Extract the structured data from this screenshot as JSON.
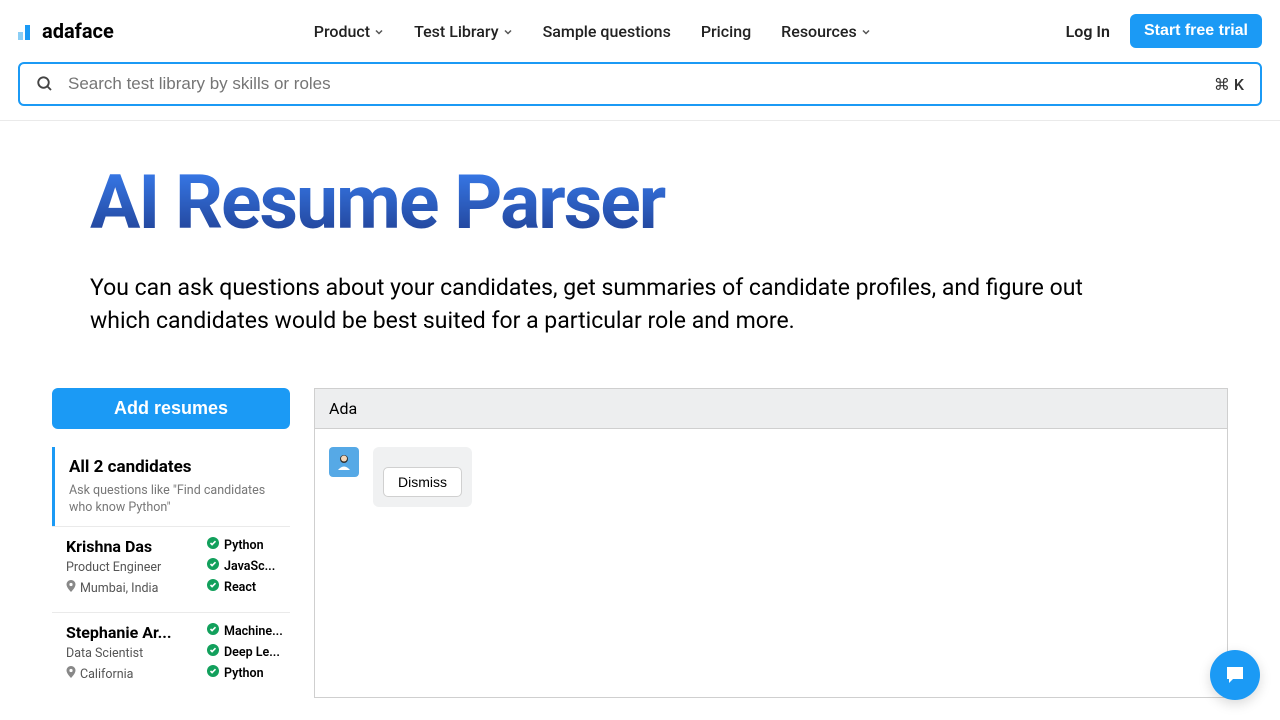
{
  "brand": "adaface",
  "nav": {
    "items": [
      {
        "label": "Product",
        "hasChevron": true
      },
      {
        "label": "Test Library",
        "hasChevron": true
      },
      {
        "label": "Sample questions",
        "hasChevron": false
      },
      {
        "label": "Pricing",
        "hasChevron": false
      },
      {
        "label": "Resources",
        "hasChevron": true
      }
    ],
    "login": "Log In",
    "trial": "Start free trial"
  },
  "search": {
    "placeholder": "Search test library by skills or roles",
    "kbd": "⌘ K"
  },
  "hero": {
    "title": "AI Resume Parser",
    "sub": "You can ask questions about your candidates, get summaries of candidate profiles, and figure out which candidates would be best suited for a particular role and more."
  },
  "left": {
    "addBtn": "Add resumes",
    "groupTitle": "All 2 candidates",
    "groupHint": "Ask questions like \"Find candidates who know Python\"",
    "candidates": [
      {
        "name": "Krishna Das",
        "role": "Product Engineer",
        "location": "Mumbai, India",
        "tags": [
          "Python",
          "JavaSc...",
          "React"
        ]
      },
      {
        "name": "Stephanie Ar...",
        "role": "Data Scientist",
        "location": "California",
        "tags": [
          "Machine...",
          "Deep Le...",
          "Python"
        ]
      }
    ]
  },
  "panel": {
    "title": "Ada",
    "dismiss": "Dismiss"
  }
}
